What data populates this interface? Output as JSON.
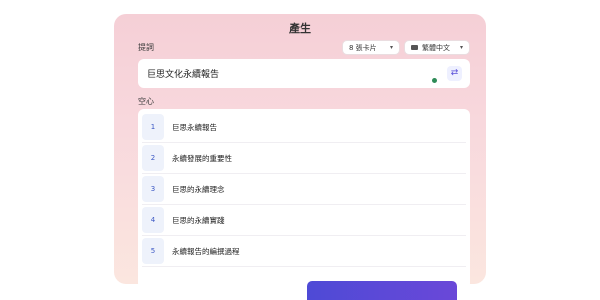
{
  "header": {
    "title": "產生"
  },
  "prompt": {
    "label": "提詞",
    "card_count": "8 張卡片",
    "language": "繁體中文",
    "value": "巨思文化永續報告"
  },
  "outline": {
    "label": "空心",
    "items": [
      {
        "num": "1",
        "text": "巨思永續報告"
      },
      {
        "num": "2",
        "text": "永續發展的重要性"
      },
      {
        "num": "3",
        "text": "巨思的永續理念"
      },
      {
        "num": "4",
        "text": "巨思的永續實踐"
      },
      {
        "num": "5",
        "text": "永續報告的編撰過程"
      }
    ]
  },
  "colors": {
    "accent": "#5a50d8",
    "panel_top": "#f5cfd6",
    "panel_bottom": "#fbe6df"
  }
}
